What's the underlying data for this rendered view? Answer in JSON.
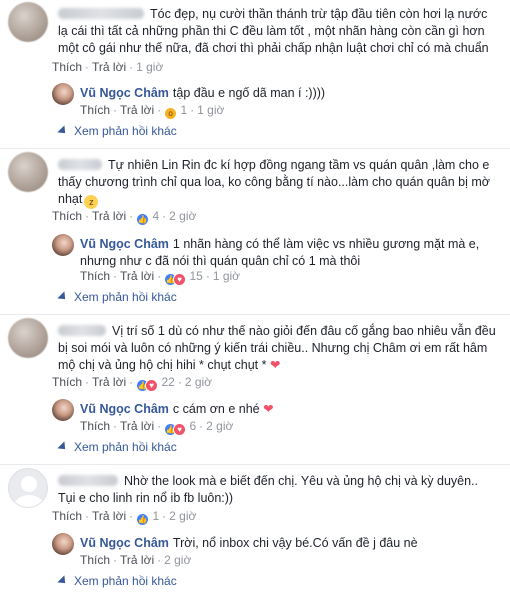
{
  "actions": {
    "like": "Thích",
    "reply": "Trả lời",
    "dot": "·"
  },
  "view_more": "Xem phản hồi khác",
  "reply_author": "Vũ Ngọc Châm",
  "comments": [
    {
      "text": "Tóc đẹp, nụ cười thần thánh trừ tập đầu tiên còn hơi lạ nước lạ cái thì tất cả những phần thi C đều làm tốt , một nhãn hàng còn cần gì hơn một cô gái như thế nữa, đã chơi thì phải chấp nhận luật chơi chỉ có mà chuẩn",
      "time": "1 giờ",
      "reply": {
        "text": "tập đầu e ngố dã man í :))))",
        "count": "1",
        "time": "1 giờ"
      }
    },
    {
      "text": "Tự nhiên Lin Rin đc kí hợp đồng ngang tầm vs quán quân ,làm cho e thấy chương trình chỉ qua loa, ko công bằng tí nào...làm cho quán quân bị mờ nhạt",
      "count": "4",
      "time": "2 giờ",
      "reply": {
        "text": "1 nhãn hàng có thể làm việc vs nhiều gương mặt mà e, nhưng như c đã nói thì quán quân chỉ có 1 mà thôi",
        "count": "15",
        "time": "1 giờ"
      }
    },
    {
      "text": "Vị trí số 1 dù có như thế nào giỏi đến đâu cố gắng bao nhiêu vẫn đều bị soi mói và luôn có những ý kiến trái chiều.. Nhưng chị Châm ơi em rất hâm mộ chị và ủng hộ chị hihi * chụt chụt *",
      "count": "22",
      "time": "2 giờ",
      "reply": {
        "text": "c cám ơn e nhé",
        "count": "6",
        "time": "2 giờ"
      }
    },
    {
      "text": "Nhờ the look mà e biết đến chị. Yêu và ủng hộ chị và kỳ duyên.. Tụi e cho linh rin nổ ib fb luôn:))",
      "count": "1",
      "time": "2 giờ",
      "reply": {
        "text": "Trời, nổ inbox chi vậy bé.Có vấn đề j đâu nè",
        "time": "2 giờ"
      }
    }
  ]
}
